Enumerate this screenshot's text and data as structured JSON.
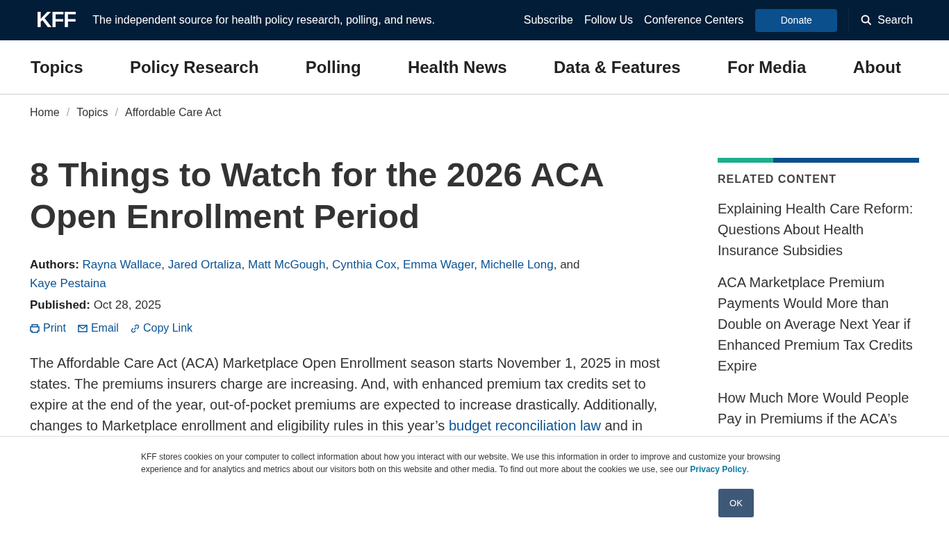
{
  "topbar": {
    "logo": "KFF",
    "tagline": "The independent source for health policy research, polling, and news.",
    "links": [
      "Subscribe",
      "Follow Us",
      "Conference Centers"
    ],
    "donate": "Donate",
    "search": "Search"
  },
  "nav": [
    "Topics",
    "Policy Research",
    "Polling",
    "Health News",
    "Data & Features",
    "For Media",
    "About"
  ],
  "breadcrumb": {
    "separator": "/",
    "items": [
      "Home",
      "Topics",
      "Affordable Care Act"
    ]
  },
  "article": {
    "title": "8 Things to Watch for the 2026 ACA Open Enrollment Period",
    "authors_label": "Authors:",
    "authors": [
      "Rayna Wallace",
      "Jared Ortaliza",
      "Matt McGough",
      "Cynthia Cox",
      "Emma Wager",
      "Michelle Long",
      "Kaye Pestaina"
    ],
    "authors_separator": ",",
    "authors_and": "and",
    "published_label": "Published:",
    "published": "Oct 28, 2025",
    "actions": [
      {
        "kind": "print",
        "label": "Print"
      },
      {
        "kind": "email",
        "label": "Email"
      },
      {
        "kind": "link",
        "label": "Copy Link"
      }
    ],
    "body": [
      {
        "kind": "text",
        "text": "The Affordable Care Act (ACA) Marketplace Open Enrollment season starts November 1, 2025 in most states. The premiums insurers charge are increasing. And, with enhanced premium tax credits set to expire at the end of the year, out-of-pocket premiums are expected to increase drastically. Additionally, changes to Marketplace enrollment and eligibility rules in this year’s "
      },
      {
        "kind": "link",
        "text": "budget reconciliation law"
      },
      {
        "kind": "text",
        "text": " and in"
      }
    ]
  },
  "related": {
    "heading": "RELATED CONTENT",
    "items": [
      "Explaining Health Care Reform: Questions About Health Insurance Subsidies",
      "ACA Marketplace Premium Payments Would More than Double on Average Next Year if Enhanced Premium Tax Credits Expire",
      "How Much More Would People Pay in Premiums if the ACA’s"
    ]
  },
  "cookie": {
    "text": "KFF stores cookies on your computer to collect information about how you interact with our website. We use this information in order to improve and customize your browsing experience and for analytics and metrics about our visitors both on this website and other media. To find out more about the cookies we use, see our ",
    "link": "Privacy Policy",
    "end": ".",
    "button": "OK"
  }
}
